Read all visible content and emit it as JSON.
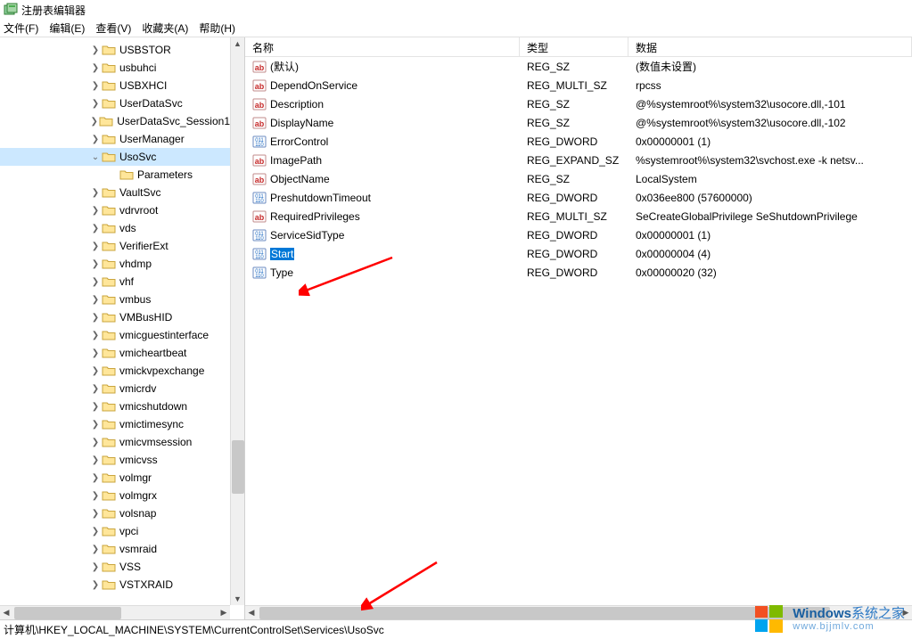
{
  "title": "注册表编辑器",
  "menu": {
    "file": "文件(F)",
    "edit": "编辑(E)",
    "view": "查看(V)",
    "favorites": "收藏夹(A)",
    "help": "帮助(H)"
  },
  "tree": {
    "items": [
      {
        "depth": 5,
        "exp": ">",
        "label": "USBSTOR"
      },
      {
        "depth": 5,
        "exp": ">",
        "label": "usbuhci"
      },
      {
        "depth": 5,
        "exp": ">",
        "label": "USBXHCI"
      },
      {
        "depth": 5,
        "exp": ">",
        "label": "UserDataSvc"
      },
      {
        "depth": 5,
        "exp": ">",
        "label": "UserDataSvc_Session1"
      },
      {
        "depth": 5,
        "exp": ">",
        "label": "UserManager"
      },
      {
        "depth": 5,
        "exp": "v",
        "label": "UsoSvc",
        "selected": true
      },
      {
        "depth": 6,
        "exp": "",
        "label": "Parameters"
      },
      {
        "depth": 5,
        "exp": ">",
        "label": "VaultSvc"
      },
      {
        "depth": 5,
        "exp": ">",
        "label": "vdrvroot"
      },
      {
        "depth": 5,
        "exp": ">",
        "label": "vds"
      },
      {
        "depth": 5,
        "exp": ">",
        "label": "VerifierExt"
      },
      {
        "depth": 5,
        "exp": ">",
        "label": "vhdmp"
      },
      {
        "depth": 5,
        "exp": ">",
        "label": "vhf"
      },
      {
        "depth": 5,
        "exp": ">",
        "label": "vmbus"
      },
      {
        "depth": 5,
        "exp": ">",
        "label": "VMBusHID"
      },
      {
        "depth": 5,
        "exp": ">",
        "label": "vmicguestinterface"
      },
      {
        "depth": 5,
        "exp": ">",
        "label": "vmicheartbeat"
      },
      {
        "depth": 5,
        "exp": ">",
        "label": "vmickvpexchange"
      },
      {
        "depth": 5,
        "exp": ">",
        "label": "vmicrdv"
      },
      {
        "depth": 5,
        "exp": ">",
        "label": "vmicshutdown"
      },
      {
        "depth": 5,
        "exp": ">",
        "label": "vmictimesync"
      },
      {
        "depth": 5,
        "exp": ">",
        "label": "vmicvmsession"
      },
      {
        "depth": 5,
        "exp": ">",
        "label": "vmicvss"
      },
      {
        "depth": 5,
        "exp": ">",
        "label": "volmgr"
      },
      {
        "depth": 5,
        "exp": ">",
        "label": "volmgrx"
      },
      {
        "depth": 5,
        "exp": ">",
        "label": "volsnap"
      },
      {
        "depth": 5,
        "exp": ">",
        "label": "vpci"
      },
      {
        "depth": 5,
        "exp": ">",
        "label": "vsmraid"
      },
      {
        "depth": 5,
        "exp": ">",
        "label": "VSS"
      },
      {
        "depth": 5,
        "exp": ">",
        "label": "VSTXRAID"
      }
    ]
  },
  "list": {
    "headers": {
      "name": "名称",
      "type": "类型",
      "data": "数据"
    },
    "rows": [
      {
        "icon": "str",
        "name": "(默认)",
        "type": "REG_SZ",
        "data": "(数值未设置)"
      },
      {
        "icon": "str",
        "name": "DependOnService",
        "type": "REG_MULTI_SZ",
        "data": "rpcss"
      },
      {
        "icon": "str",
        "name": "Description",
        "type": "REG_SZ",
        "data": "@%systemroot%\\system32\\usocore.dll,-101"
      },
      {
        "icon": "str",
        "name": "DisplayName",
        "type": "REG_SZ",
        "data": "@%systemroot%\\system32\\usocore.dll,-102"
      },
      {
        "icon": "bin",
        "name": "ErrorControl",
        "type": "REG_DWORD",
        "data": "0x00000001 (1)"
      },
      {
        "icon": "str",
        "name": "ImagePath",
        "type": "REG_EXPAND_SZ",
        "data": "%systemroot%\\system32\\svchost.exe -k netsv..."
      },
      {
        "icon": "str",
        "name": "ObjectName",
        "type": "REG_SZ",
        "data": "LocalSystem"
      },
      {
        "icon": "bin",
        "name": "PreshutdownTimeout",
        "type": "REG_DWORD",
        "data": "0x036ee800 (57600000)"
      },
      {
        "icon": "str",
        "name": "RequiredPrivileges",
        "type": "REG_MULTI_SZ",
        "data": "SeCreateGlobalPrivilege SeShutdownPrivilege"
      },
      {
        "icon": "bin",
        "name": "ServiceSidType",
        "type": "REG_DWORD",
        "data": "0x00000001 (1)"
      },
      {
        "icon": "bin",
        "name": "Start",
        "type": "REG_DWORD",
        "data": "0x00000004 (4)",
        "selected": true
      },
      {
        "icon": "bin",
        "name": "Type",
        "type": "REG_DWORD",
        "data": "0x00000020 (32)"
      }
    ]
  },
  "statusbar": "计算机\\HKEY_LOCAL_MACHINE\\SYSTEM\\CurrentControlSet\\Services\\UsoSvc",
  "watermark": {
    "line1a": "Windows",
    "line1b": "系统之家",
    "line2": "www.bjjmlv.com"
  }
}
